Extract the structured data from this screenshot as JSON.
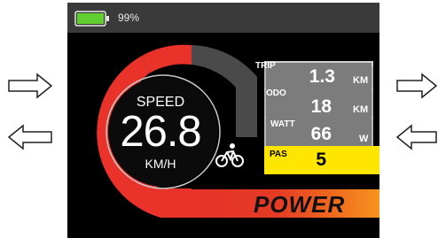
{
  "status": {
    "battery_percent": "99%",
    "battery_level": 1.0,
    "battery_color": "#5fce2e"
  },
  "speed": {
    "label": "SPEED",
    "value": "26.8",
    "unit": "KM/H"
  },
  "stats": [
    {
      "label": "TRIP",
      "value": "1.3",
      "unit": "KM"
    },
    {
      "label": "ODO",
      "value": "18",
      "unit": "KM"
    },
    {
      "label": "WATT",
      "value": "66",
      "unit": "W"
    }
  ],
  "pas": {
    "label": "PAS",
    "value": "5"
  },
  "power_label": "POWER",
  "icons": {
    "bike": "bicycle-icon",
    "left_arrows": "arrow-icon",
    "right_arrows": "arrow-icon"
  },
  "colors": {
    "gauge_red": "#e8322a",
    "gauge_gray": "#4a4a4a",
    "pas_yellow": "#ffe600"
  }
}
